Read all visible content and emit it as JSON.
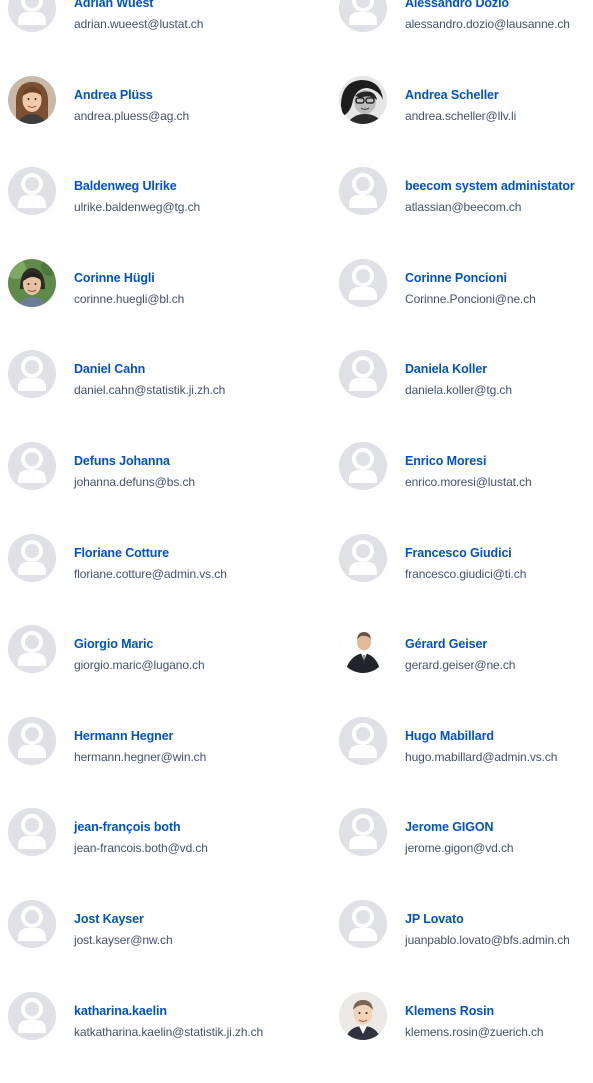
{
  "people": [
    {
      "name": "Adrian Wüest",
      "email": "adrian.wueest@lustat.ch",
      "avatar": "default-avatar-icon"
    },
    {
      "name": "Alessandro Dozio",
      "email": "alessandro.dozio@lausanne.ch",
      "avatar": "default-avatar-icon"
    },
    {
      "name": "Andrea Plüss",
      "email": "andrea.pluess@ag.ch",
      "avatar": "photo-woman-long-hair"
    },
    {
      "name": "Andrea Scheller",
      "email": "andrea.scheller@llv.li",
      "avatar": "photo-woman-dark-hair-bw"
    },
    {
      "name": "Baldenweg Ulrike",
      "email": "ulrike.baldenweg@tg.ch",
      "avatar": "default-avatar-icon"
    },
    {
      "name": "beecom system administator",
      "email": "atlassian@beecom.ch",
      "avatar": "default-avatar-icon"
    },
    {
      "name": "Corinne Hügli",
      "email": "corinne.huegli@bl.ch",
      "avatar": "photo-woman-outdoor"
    },
    {
      "name": "Corinne Poncioni",
      "email": "Corinne.Poncioni@ne.ch",
      "avatar": "default-avatar-icon"
    },
    {
      "name": "Daniel Cahn",
      "email": "daniel.cahn@statistik.ji.zh.ch",
      "avatar": "default-avatar-icon"
    },
    {
      "name": "Daniela Koller",
      "email": "daniela.koller@tg.ch",
      "avatar": "default-avatar-icon"
    },
    {
      "name": "Defuns Johanna",
      "email": "johanna.defuns@bs.ch",
      "avatar": "default-avatar-icon"
    },
    {
      "name": "Enrico Moresi",
      "email": "enrico.moresi@lustat.ch",
      "avatar": "default-avatar-icon"
    },
    {
      "name": "Floriane Cotture",
      "email": "floriane.cotture@admin.vs.ch",
      "avatar": "default-avatar-icon"
    },
    {
      "name": "Francesco Giudici",
      "email": "francesco.giudici@ti.ch",
      "avatar": "default-avatar-icon"
    },
    {
      "name": "Giorgio Maric",
      "email": "giorgio.maric@lugano.ch",
      "avatar": "default-avatar-icon"
    },
    {
      "name": "Gérard Geiser",
      "email": "gerard.geiser@ne.ch",
      "avatar": "photo-man-suit"
    },
    {
      "name": "Hermann Hegner",
      "email": "hermann.hegner@win.ch",
      "avatar": "default-avatar-icon"
    },
    {
      "name": "Hugo Mabillard",
      "email": "hugo.mabillard@admin.vs.ch",
      "avatar": "default-avatar-icon"
    },
    {
      "name": "jean-françois both",
      "email": "jean-francois.both@vd.ch",
      "avatar": "default-avatar-icon"
    },
    {
      "name": "Jerome GIGON",
      "email": "jerome.gigon@vd.ch",
      "avatar": "default-avatar-icon"
    },
    {
      "name": "Jost Kayser",
      "email": "jost.kayser@nw.ch",
      "avatar": "default-avatar-icon"
    },
    {
      "name": "JP Lovato",
      "email": "juanpablo.lovato@bfs.admin.ch",
      "avatar": "default-avatar-icon"
    },
    {
      "name": "katharina.kaelin",
      "email": "katkatharina.kaelin@statistik.ji.zh.ch",
      "avatar": "default-avatar-icon"
    },
    {
      "name": "Klemens Rosin",
      "email": "klemens.rosin@zuerich.ch",
      "avatar": "photo-man-light-background"
    }
  ],
  "colors": {
    "name_link": "#0052cc",
    "email_text": "#42526e",
    "avatar_bg": "#dfe1e6",
    "avatar_glyph": "#ffffff"
  }
}
